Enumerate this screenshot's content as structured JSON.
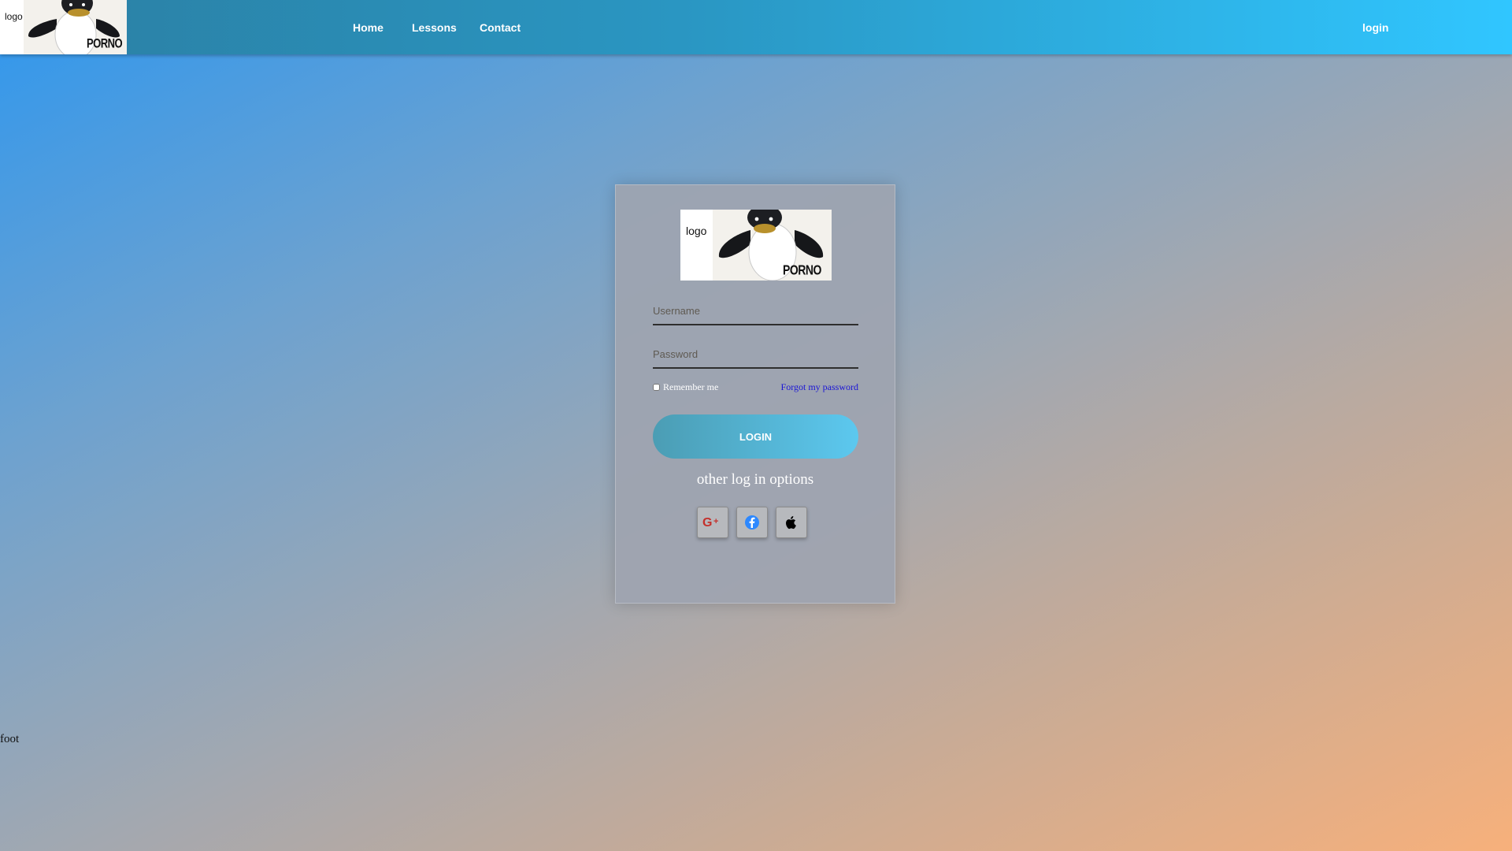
{
  "header": {
    "logo_alt": "logo",
    "logo_caption": "PORNO",
    "nav": {
      "home": "Home",
      "lessons": "Lessons",
      "contact": "Contact",
      "login": "login"
    }
  },
  "login_card": {
    "logo_alt": "logo",
    "logo_caption": "PORNO",
    "username_placeholder": "Username",
    "password_placeholder": "Password",
    "remember_label": "Remember me",
    "remember_checked": false,
    "forgot_link": "Forgot my password",
    "login_button": "LOGIN",
    "other_options_label": "other log in options",
    "social_buttons": [
      {
        "icon": "google-plus-icon",
        "color": "#c4302b"
      },
      {
        "icon": "facebook-icon",
        "color": "#2d88ff"
      },
      {
        "icon": "apple-icon",
        "color": "#000000"
      }
    ]
  },
  "footer": {
    "text": "foot"
  },
  "colors": {
    "header_gradient_start": "#2b7fa3",
    "header_gradient_end": "#30c6ff",
    "background_gradient_start": "#2f97ee",
    "background_gradient_end": "#f7b07b",
    "login_button_start": "#4b9db4",
    "login_button_end": "#5cc8ef",
    "forgot_link": "#1a14d6"
  }
}
